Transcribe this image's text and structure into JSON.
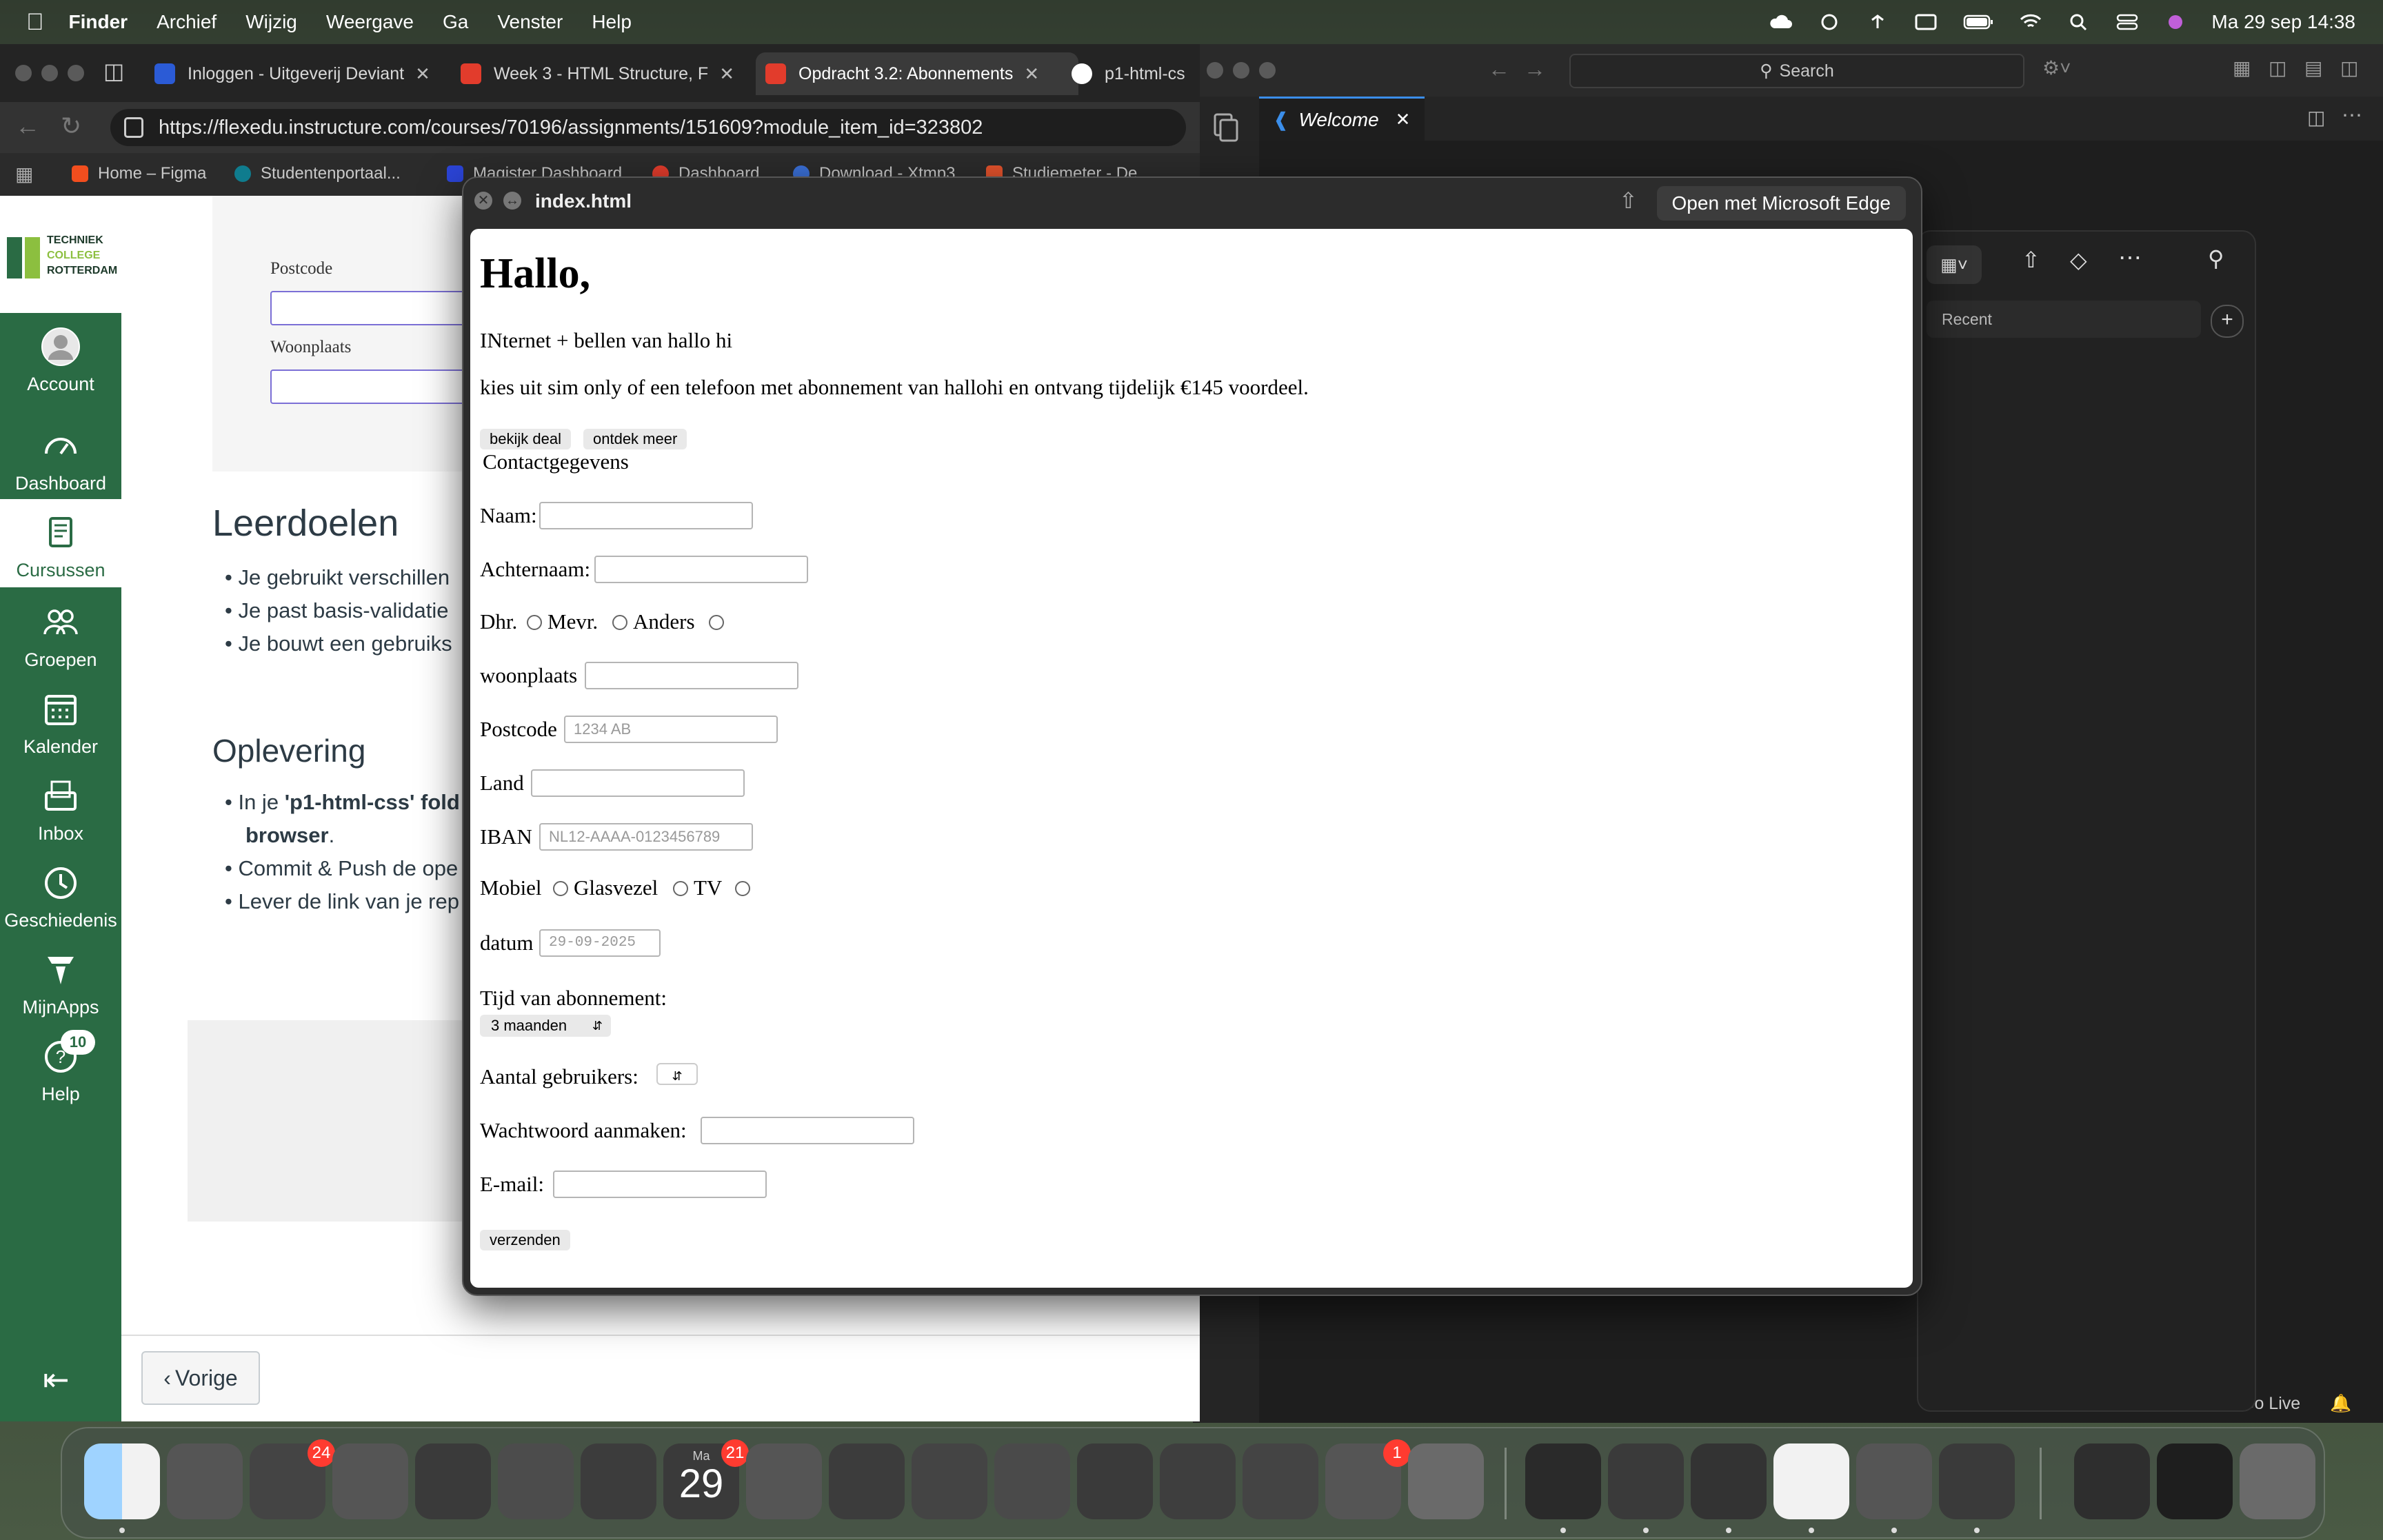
{
  "menubar": {
    "items": [
      "Finder",
      "Archief",
      "Wijzig",
      "Weergave",
      "Ga",
      "Venster",
      "Help"
    ],
    "datetime": "Ma 29 sep  14:38"
  },
  "browser": {
    "tabs": [
      {
        "title": "Inloggen - Uitgeverij Deviant",
        "color": "#2b5bd6"
      },
      {
        "title": "Week 3 - HTML Structure, F",
        "color": "#e23c2c"
      },
      {
        "title": "Opdracht 3.2: Abonnements",
        "color": "#e23c2c"
      },
      {
        "title": "p1-html-cs",
        "color": "#ffffff"
      }
    ],
    "url": "https://flexedu.instructure.com/courses/70196/assignments/151609?module_item_id=323802",
    "bookmarks": [
      "Home – Figma",
      "Studentenportaal...",
      "Magister Dashboard",
      "Dashboard",
      "Download - Xtmp3",
      "Studiemeter - De..."
    ]
  },
  "canvas": {
    "logo_lines": [
      "TECHNIEK",
      "COLLEGE",
      "ROTTERDAM"
    ],
    "nav": [
      {
        "label": "Account",
        "icon": "account-icon"
      },
      {
        "label": "Dashboard",
        "icon": "dashboard-icon"
      },
      {
        "label": "Cursussen",
        "icon": "courses-icon"
      },
      {
        "label": "Groepen",
        "icon": "groups-icon"
      },
      {
        "label": "Kalender",
        "icon": "calendar-icon"
      },
      {
        "label": "Inbox",
        "icon": "inbox-icon"
      },
      {
        "label": "Geschiedenis",
        "icon": "history-icon"
      },
      {
        "label": "MijnApps",
        "icon": "myapps-icon"
      },
      {
        "label": "Help",
        "icon": "help-icon"
      }
    ],
    "help_badge": "10",
    "form_labels": [
      "Postcode",
      "Woonplaats"
    ],
    "leerdoelen_title": "Leerdoelen",
    "leerdoelen": [
      "Je gebruikt verschillen",
      "Je past basis-validatie",
      "Je bouwt een gebruiks"
    ],
    "oplevering_title": "Oplevering",
    "oplevering": {
      "item1_prefix": "In je ",
      "item1_bold": "'p1-html-css' fold",
      "item1_cont_bold": "browser",
      "item1_cont_rest": ".",
      "item2": "Commit & Push de ope",
      "item3": "Lever de link van je rep"
    },
    "vorige": "Vorige"
  },
  "vscode": {
    "search": "Search",
    "tab": "Welcome",
    "recent": "Recent",
    "golive": "Go Live"
  },
  "quicklook": {
    "filename": "index.html",
    "open_with": "Open met Microsoft Edge",
    "page": {
      "heading": "Hallo,",
      "line1": "INternet + bellen van hallo hi",
      "line2": "kies uit sim only of een telefoon met abonnement van hallohi en ontvang tijdelijk €145 voordeel.",
      "btn_deal": "bekijk deal",
      "btn_more": "ontdek meer",
      "contact": "Contactgegevens",
      "naam": "Naam:",
      "achternaam": "Achternaam:",
      "salutations": [
        "Dhr.",
        "Mevr.",
        "Anders"
      ],
      "woonplaats": "woonplaats",
      "postcode": "Postcode",
      "postcode_ph": "1234 AB",
      "land": "Land",
      "iban": "IBAN",
      "iban_ph": "NL12-AAAA-0123456789",
      "services": [
        "Mobiel",
        "Glasvezel",
        "TV"
      ],
      "datum": "datum",
      "datum_val": "29-09-2025",
      "tijd": "Tijd van abonnement:",
      "tijd_val": "3 maanden",
      "aantal": "Aantal gebruikers:",
      "wachtwoord": "Wachtwoord aanmaken:",
      "email": "E-mail:",
      "submit": "verzenden"
    }
  },
  "dock": {
    "badges": {
      "messages": "24",
      "calendar": "21",
      "settings": "1"
    },
    "calendar_day": "29",
    "calendar_month": "Ma"
  }
}
